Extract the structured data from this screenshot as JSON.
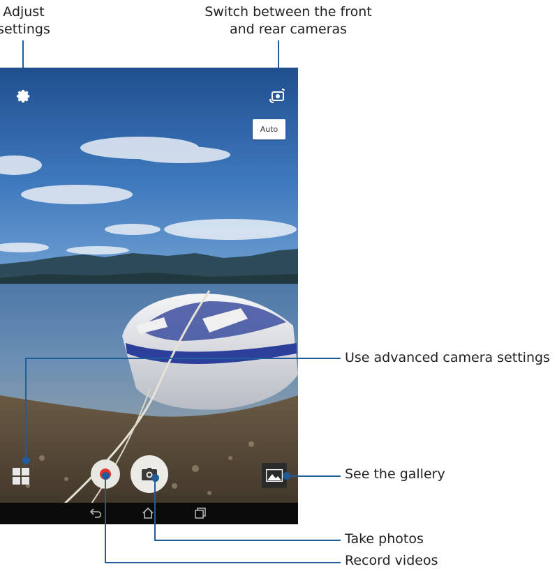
{
  "callouts": {
    "settings": [
      "Adjust",
      "settings"
    ],
    "switch_camera": [
      "Switch between the front",
      "and rear cameras"
    ],
    "advanced": "Use advanced camera settings",
    "gallery": "See the gallery",
    "take_photos": "Take photos",
    "record_videos": "Record videos"
  },
  "camera_ui": {
    "mode_button": "Auto",
    "icons": {
      "settings": "gear-icon",
      "switch_camera": "switch-camera-icon",
      "advanced": "grid-modes-icon",
      "record": "record-icon",
      "shutter": "camera-icon",
      "gallery": "gallery-icon",
      "back": "back-icon",
      "home": "home-icon",
      "recents": "recents-icon"
    }
  },
  "colors": {
    "callout_line": "#1f5c99",
    "record_dot": "#e1322b",
    "text": "#231f20"
  }
}
